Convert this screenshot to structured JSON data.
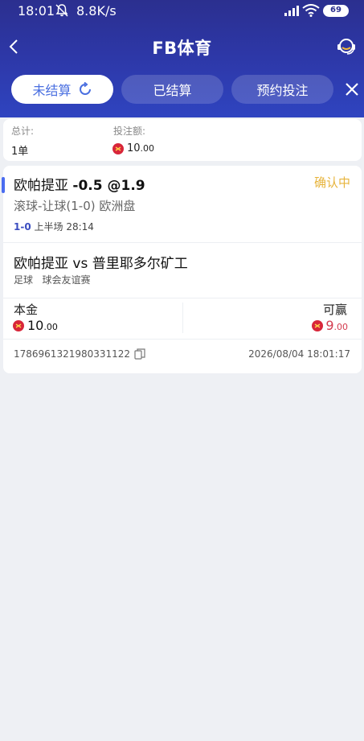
{
  "status_bar": {
    "time": "18:01",
    "net_speed": "8.8K/s",
    "battery": "69"
  },
  "header": {
    "title": "FB体育"
  },
  "tabs": [
    {
      "label": "未结算"
    },
    {
      "label": "已结算"
    },
    {
      "label": "预约投注"
    }
  ],
  "summary": {
    "total_label": "总计:",
    "total_value": "1单",
    "stake_label": "投注额:",
    "stake_int": "10",
    "stake_dec": ".00"
  },
  "bet": {
    "team": "欧帕提亚",
    "odds_text": "-0.5 @1.9",
    "status": "确认中",
    "market": "滚球-让球(1-0) 欧洲盘",
    "live_score": "1-0",
    "live_time": "上半场 28:14",
    "match": "欧帕提亚 vs 普里耶多尔矿工",
    "sport": "足球",
    "league": "球会友谊赛",
    "stake_label": "本金",
    "stake_int": "10",
    "stake_dec": ".00",
    "win_label": "可赢",
    "win_int": "9",
    "win_dec": ".00",
    "order_id": "1786961321980331122",
    "datetime": "2026/08/04 18:01:17"
  },
  "colors": {
    "header_top": "#2b2f8f",
    "accent_blue": "#4a6cf0",
    "status_confirming": "#e7b43c",
    "win_red": "#d33c4f"
  }
}
